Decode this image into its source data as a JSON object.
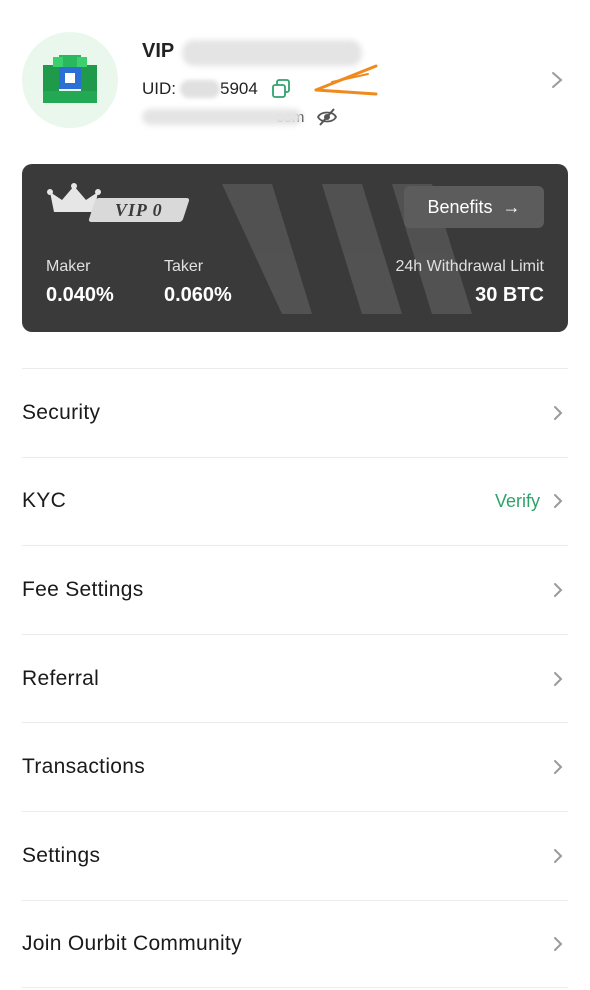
{
  "profile": {
    "name_prefix": "VIP",
    "uid_label": "UID:",
    "uid_visible_suffix": "5904",
    "email_visible_suffix": "com"
  },
  "vip_card": {
    "badge": "VIP 0",
    "benefits_label": "Benefits",
    "benefits_arrow": "→",
    "maker_label": "Maker",
    "maker_value": "0.040%",
    "taker_label": "Taker",
    "taker_value": "0.060%",
    "withdrawal_label": "24h Withdrawal Limit",
    "withdrawal_value": "30 BTC"
  },
  "menu": {
    "items": [
      {
        "label": "Security",
        "status": ""
      },
      {
        "label": "KYC",
        "status": "Verify"
      },
      {
        "label": "Fee Settings",
        "status": ""
      },
      {
        "label": "Referral",
        "status": ""
      },
      {
        "label": "Transactions",
        "status": ""
      },
      {
        "label": "Settings",
        "status": ""
      },
      {
        "label": "Join Ourbit Community",
        "status": ""
      }
    ]
  },
  "colors": {
    "accent_green": "#2fa36b",
    "card_bg": "#3a3a3a",
    "annotation_orange": "#f08a1c"
  }
}
